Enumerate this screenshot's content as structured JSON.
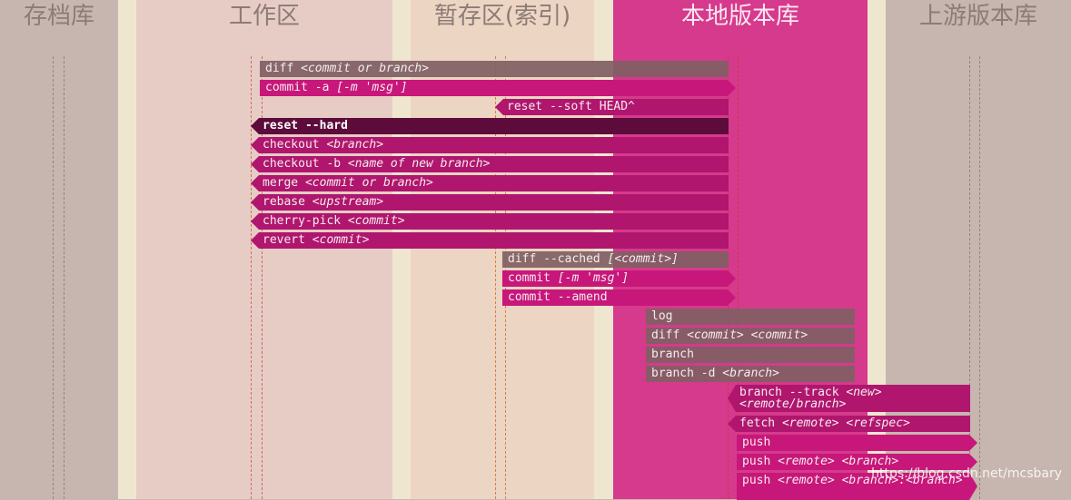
{
  "columns": {
    "stash": "存档库",
    "workspace": "工作区",
    "index": "暂存区(索引)",
    "local": "本地版本库",
    "upstream": "上游版本库"
  },
  "commands": [
    {
      "cmd": "diff",
      "args": "<commit or branch>"
    },
    {
      "cmd": "commit -a",
      "args": "[-m 'msg']"
    },
    {
      "cmd": "reset --soft HEAD^",
      "args": ""
    },
    {
      "cmd": "reset --hard",
      "args": ""
    },
    {
      "cmd": "checkout",
      "args": "<branch>"
    },
    {
      "cmd": "checkout -b",
      "args": "<name of new branch>"
    },
    {
      "cmd": "merge",
      "args": "<commit or branch>"
    },
    {
      "cmd": "rebase",
      "args": "<upstream>"
    },
    {
      "cmd": "cherry-pick",
      "args": "<commit>"
    },
    {
      "cmd": "revert",
      "args": "<commit>"
    },
    {
      "cmd": "diff --cached",
      "args": "[<commit>]"
    },
    {
      "cmd": "commit",
      "args": "[-m 'msg']"
    },
    {
      "cmd": "commit --amend",
      "args": ""
    },
    {
      "cmd": "log",
      "args": ""
    },
    {
      "cmd": "diff",
      "args": "<commit> <commit>"
    },
    {
      "cmd": "branch",
      "args": ""
    },
    {
      "cmd": "branch -d",
      "args": "<branch>"
    },
    {
      "cmd": "branch --track",
      "args": "<new> <remote/branch>"
    },
    {
      "cmd": "fetch",
      "args": "<remote> <refspec>"
    },
    {
      "cmd": "push",
      "args": ""
    },
    {
      "cmd": "push",
      "args": "<remote> <branch>"
    },
    {
      "cmd": "push",
      "args": "<remote> <branch>:<branch>"
    }
  ],
  "watermark": "https://blog.csdn.net/mcsbary",
  "colors": {
    "magenta": "#b0166e",
    "pink": "#c8177a",
    "dark": "#5c0b3b",
    "gray": "#806063",
    "local_column": "#d63a8c"
  }
}
